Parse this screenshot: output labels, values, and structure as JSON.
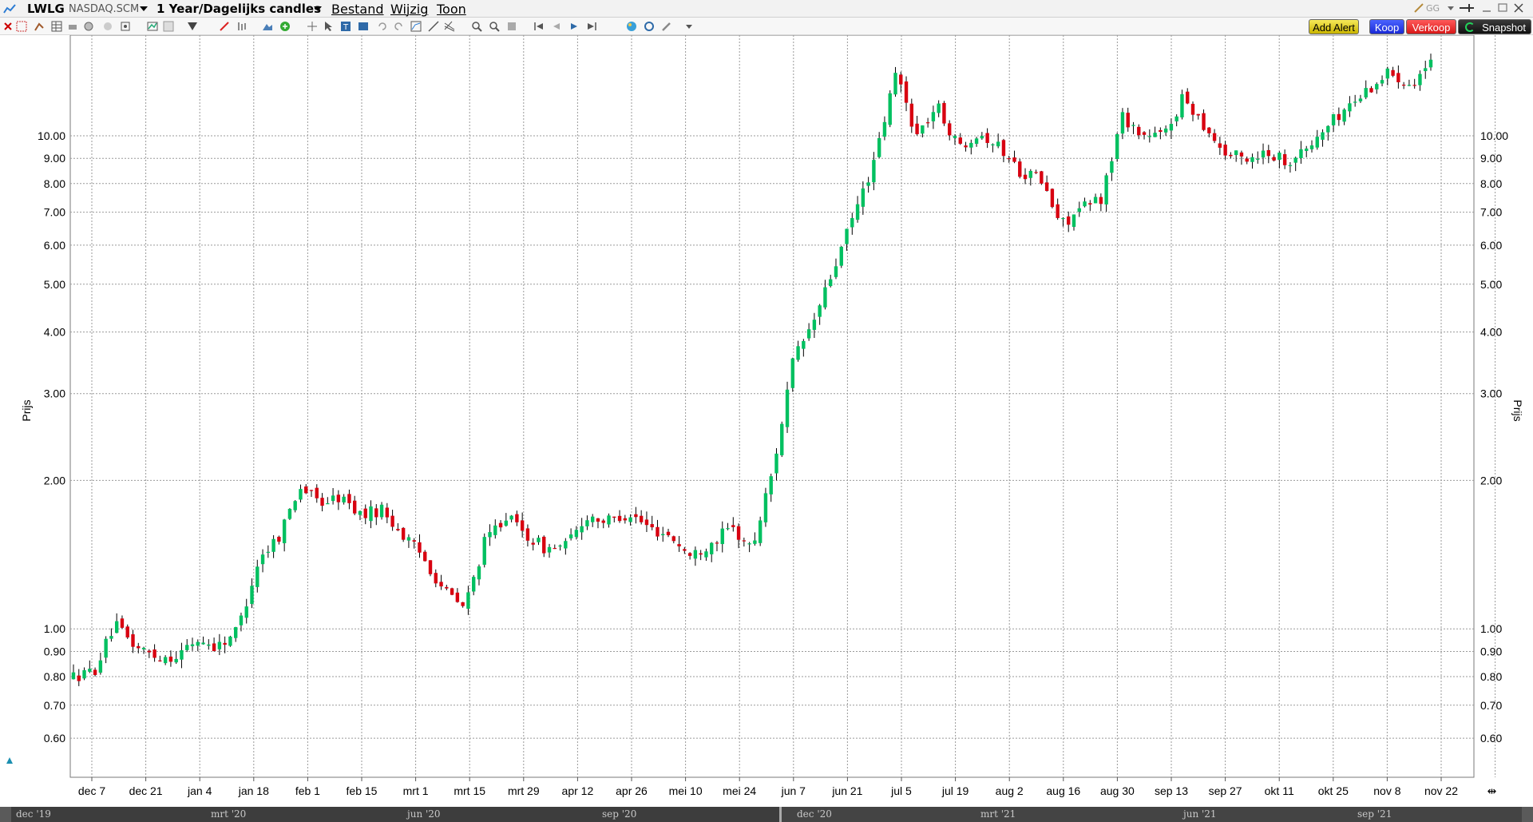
{
  "window": {
    "symbol": "LWLG",
    "exchange": "NASDAQ.SCM",
    "period": "1 Year/Dagelijks candles",
    "menus": [
      "Bestand",
      "Wijzig",
      "Toon"
    ]
  },
  "toolbar": {
    "add_alert_label": "Add Alert",
    "buy_label": "Koop",
    "sell_label": "Verkoop",
    "snapshot_label": "Snapshot"
  },
  "colors": {
    "up": "#00c060",
    "down": "#d80010",
    "wick": "#000000",
    "grid": "#9a9a9a"
  },
  "chart_data": {
    "type": "candlestick",
    "ylabel": "Prijs",
    "y_scale": "log",
    "ylim": [
      0.5,
      16
    ],
    "y_ticks": [
      0.6,
      0.7,
      0.8,
      0.9,
      1.0,
      2.0,
      3.0,
      4.0,
      5.0,
      6.0,
      7.0,
      8.0,
      9.0,
      10.0
    ],
    "y_tick_labels": [
      "0.60",
      "0.70",
      "0.80",
      "0.90",
      "1.00",
      "2.00",
      "3.00",
      "4.00",
      "5.00",
      "6.00",
      "7.00",
      "8.00",
      "9.00",
      "10.00"
    ],
    "x_ticks": [
      "dec 7",
      "dec 21",
      "jan 4",
      "jan 18",
      "feb 1",
      "feb 15",
      "mrt 1",
      "mrt 15",
      "mrt 29",
      "apr 12",
      "apr 26",
      "mei 10",
      "mei 24",
      "jun 7",
      "jun 21",
      "jul 5",
      "jul 19",
      "aug 2",
      "aug 16",
      "aug 30",
      "sep 13",
      "sep 27",
      "okt 11",
      "okt 25",
      "nov 8",
      "nov 22"
    ],
    "close_path": [
      0.8,
      0.82,
      1.02,
      0.92,
      0.88,
      0.88,
      0.95,
      0.92,
      1.0,
      1.38,
      1.55,
      1.95,
      1.8,
      1.85,
      1.7,
      1.75,
      1.55,
      1.4,
      1.2,
      1.1,
      1.5,
      1.7,
      1.55,
      1.45,
      1.48,
      1.7,
      1.65,
      1.72,
      1.6,
      1.55,
      1.4,
      1.5,
      1.6,
      1.45,
      2.1,
      3.5,
      4.2,
      5.4,
      7.0,
      9.0,
      13.5,
      10.0,
      11.5,
      9.5,
      10.2,
      9.5,
      8.5,
      8.2,
      6.6,
      7.1,
      7.5,
      11.0,
      10.0,
      10.0,
      12.0,
      10.5,
      9.2,
      9.0,
      9.3,
      8.9,
      9.4,
      10.5,
      11.5,
      12.5,
      13.5,
      12.8,
      14.0
    ],
    "overview_labels": [
      "dec '19",
      "mrt '20",
      "jun '20",
      "sep '20",
      "dec '20",
      "mrt '21",
      "jun '21",
      "sep '21"
    ]
  }
}
